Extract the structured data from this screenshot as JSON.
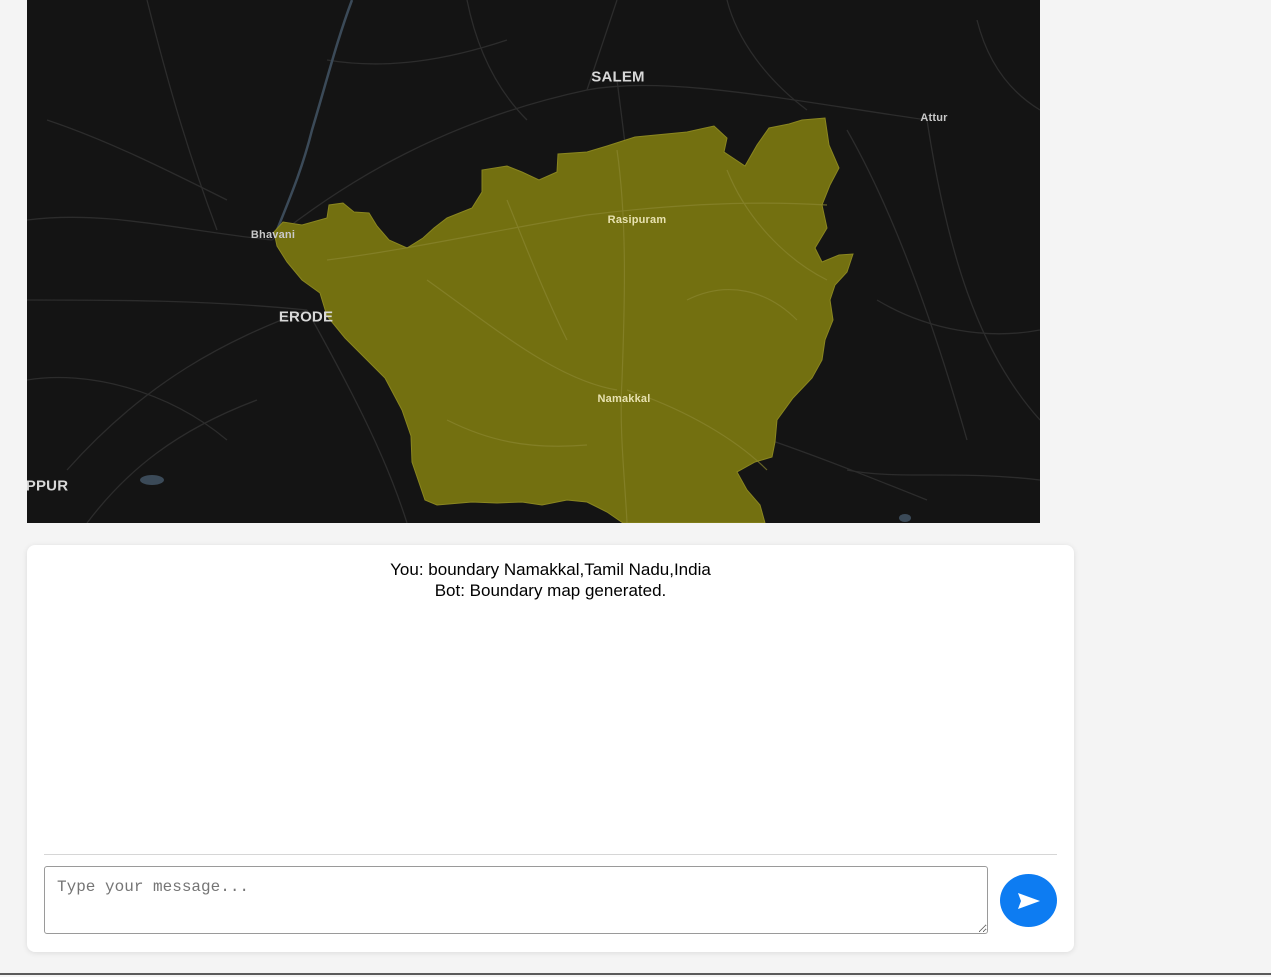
{
  "map": {
    "boundary_color": "#737010",
    "background_color": "#141414",
    "labels": {
      "salem": "SALEM",
      "attur": "Attur",
      "bhavani": "Bhavani",
      "rasipuram": "Rasipuram",
      "erode": "ERODE",
      "namakkal": "Namakkal",
      "tiruppur": "PPUR"
    }
  },
  "chat": {
    "messages": [
      {
        "text": "You: boundary Namakkal,Tamil Nadu,India"
      },
      {
        "text": "Bot: Boundary map generated."
      }
    ],
    "input": {
      "value": "",
      "placeholder": "Type your message..."
    },
    "send_icon": "send-arrow-icon",
    "accent_color": "#0d7cf2"
  }
}
